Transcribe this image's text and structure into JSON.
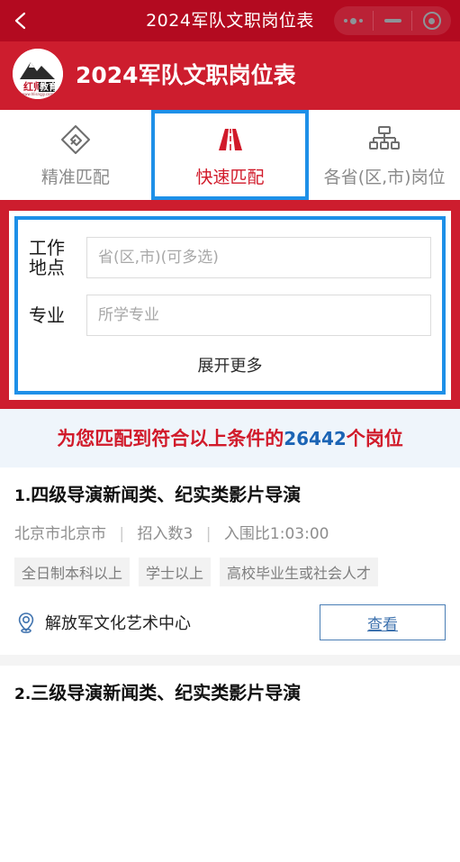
{
  "titlebar": {
    "title": "2024军队文职岗位表",
    "back_icon": "chevron-left-icon",
    "more_icon": "more-dots-icon",
    "minimize_icon": "minimize-icon",
    "close_icon": "target-circle-icon"
  },
  "brand": {
    "title": "2024军队文职岗位表",
    "logo_text_main": "红师",
    "logo_text_sub": "教育",
    "logo_url_text": "www.hlisngjy.com"
  },
  "tabs": [
    {
      "label": "精准匹配",
      "icon": "puzzle-match-icon",
      "active": false
    },
    {
      "label": "快速匹配",
      "icon": "road-fast-icon",
      "active": true
    },
    {
      "label": "各省(区,市)岗位",
      "icon": "org-tree-icon",
      "active": false
    }
  ],
  "search": {
    "location_label": "工作\n地点",
    "location_label_l1": "工作",
    "location_label_l2": "地点",
    "location_placeholder": "省(区,市)(可多选)",
    "location_value": "",
    "major_label": "专业",
    "major_placeholder": "所学专业",
    "major_value": "",
    "expand_more": "展开更多"
  },
  "match_banner": {
    "prefix": "为您匹配到符合以上条件的",
    "count": "26442",
    "suffix": "个岗位"
  },
  "jobs": [
    {
      "index": "1.",
      "title": "四级导演新闻类、纪实类影片导演",
      "location": "北京市北京市",
      "headcount": "招入数3",
      "ratio": "入围比1:03:00",
      "tags": [
        "全日制本科以上",
        "学士以上",
        "高校毕业生或社会人才"
      ],
      "org": "解放军文化艺术中心",
      "org_icon": "location-pin-icon",
      "view_label": "查看"
    },
    {
      "index": "2.",
      "title": "三级导演新闻类、纪实类影片导演"
    }
  ],
  "colors": {
    "titlebar_red": "#B30A20",
    "brand_red": "#CD1D2E",
    "accent_blue": "#1E90E8",
    "text_red": "#D11A2A",
    "count_blue": "#1B64B5",
    "banner_bg": "#EFF5FB",
    "tag_bg": "#F2F2F2",
    "view_border_blue": "#4A7EB5"
  }
}
